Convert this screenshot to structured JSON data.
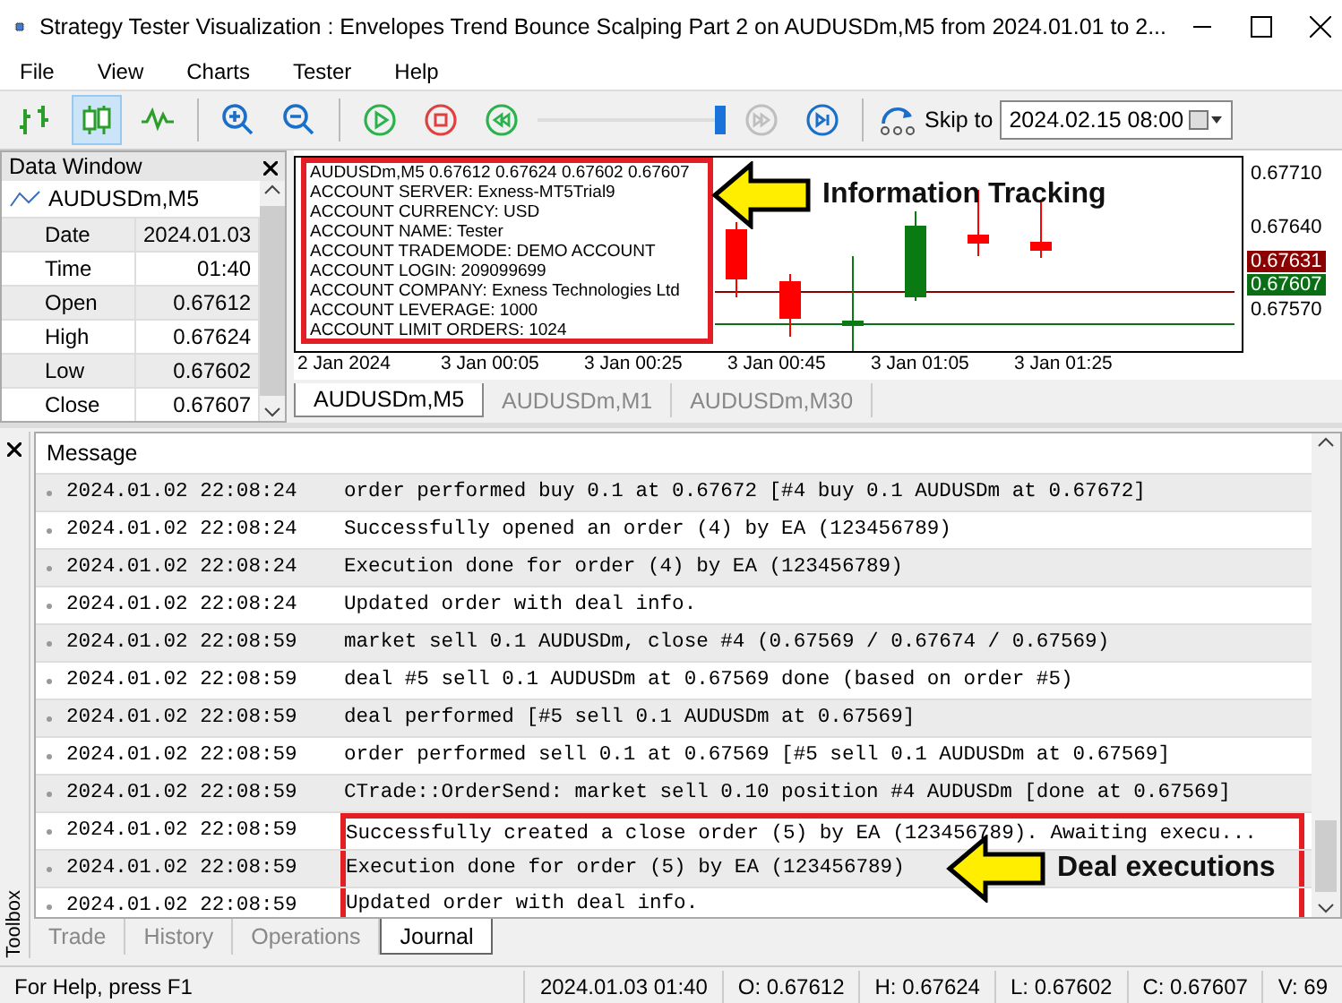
{
  "window": {
    "title": "Strategy Tester Visualization : Envelopes Trend Bounce Scalping Part 2 on AUDUSDm,M5 from 2024.01.01 to 2..."
  },
  "menu": [
    "File",
    "View",
    "Charts",
    "Tester",
    "Help"
  ],
  "toolbar": {
    "chart_types": [
      {
        "kind": "bars",
        "selected": false
      },
      {
        "kind": "candles",
        "selected": true
      },
      {
        "kind": "line",
        "selected": false
      }
    ],
    "zoom": [
      {
        "kind": "zoom-in"
      },
      {
        "kind": "zoom-out"
      }
    ],
    "playback": [
      {
        "kind": "play",
        "disabled": false
      },
      {
        "kind": "stop",
        "disabled": false
      },
      {
        "kind": "rewind",
        "disabled": false
      }
    ],
    "speed": {
      "level": 0.97
    },
    "stepping": [
      {
        "kind": "fast-forward",
        "disabled": true
      },
      {
        "kind": "step",
        "disabled": false
      }
    ],
    "skip_to": {
      "label": "Skip to",
      "value": "2024.02.15 08:00"
    }
  },
  "data_window": {
    "title": "Data Window",
    "symbol": "AUDUSDm,M5",
    "rows": [
      {
        "label": "Date",
        "value": "2024.01.03"
      },
      {
        "label": "Time",
        "value": "01:40"
      },
      {
        "label": "Open",
        "value": "0.67612"
      },
      {
        "label": "High",
        "value": "0.67624"
      },
      {
        "label": "Low",
        "value": "0.67602"
      },
      {
        "label": "Close",
        "value": "0.67607"
      }
    ]
  },
  "chart": {
    "info_lines": [
      "AUDUSDm,M5  0.67612 0.67624 0.67602 0.67607",
      "ACCOUNT SERVER:  Exness-MT5Trial9",
      "ACCOUNT CURRENCY:  USD",
      "ACCOUNT NAME:  Tester",
      "ACCOUNT TRADEMODE:  DEMO ACCOUNT",
      "ACCOUNT LOGIN:  209099699",
      "ACCOUNT COMPANY:  Exness Technologies Ltd",
      "ACCOUNT LEVERAGE:  1000",
      "ACCOUNT LIMIT ORDERS:  1024"
    ],
    "annotation": "Information Tracking",
    "price_labels": [
      {
        "text": "0.67710",
        "kind": "axis"
      },
      {
        "text": "0.67640",
        "kind": "axis"
      },
      {
        "text": "0.67631",
        "kind": "ask"
      },
      {
        "text": "0.67607",
        "kind": "bid"
      },
      {
        "text": "0.67570",
        "kind": "axis"
      }
    ],
    "time_labels": [
      "2 Jan 2024",
      "3 Jan 00:05",
      "3 Jan 00:25",
      "3 Jan 00:45",
      "3 Jan 01:05",
      "3 Jan 01:25"
    ],
    "tabs": [
      {
        "label": "AUDUSDm,M5",
        "selected": true
      },
      {
        "label": "AUDUSDm,M1",
        "selected": false
      },
      {
        "label": "AUDUSDm,M30",
        "selected": false
      }
    ]
  },
  "toolbox": {
    "title": "Toolbox",
    "column": "Message",
    "annotation": "Deal executions",
    "rows": [
      {
        "time": "2024.01.02 22:08:24",
        "message": "order performed buy 0.1 at 0.67672 [#4 buy 0.1 AUDUSDm at 0.67672]",
        "highlighted": false
      },
      {
        "time": "2024.01.02 22:08:24",
        "message": "Successfully opened an order (4) by EA (123456789)",
        "highlighted": false
      },
      {
        "time": "2024.01.02 22:08:24",
        "message": "Execution done for order (4) by EA (123456789)",
        "highlighted": false
      },
      {
        "time": "2024.01.02 22:08:24",
        "message": "Updated order with deal info.",
        "highlighted": false
      },
      {
        "time": "2024.01.02 22:08:59",
        "message": "market sell 0.1 AUDUSDm, close #4 (0.67569 / 0.67674 / 0.67569)",
        "highlighted": false
      },
      {
        "time": "2024.01.02 22:08:59",
        "message": "deal #5 sell 0.1 AUDUSDm at 0.67569 done (based on order #5)",
        "highlighted": false
      },
      {
        "time": "2024.01.02 22:08:59",
        "message": "deal performed [#5 sell 0.1 AUDUSDm at 0.67569]",
        "highlighted": false
      },
      {
        "time": "2024.01.02 22:08:59",
        "message": "order performed sell 0.1 at 0.67569 [#5 sell 0.1 AUDUSDm at 0.67569]",
        "highlighted": false
      },
      {
        "time": "2024.01.02 22:08:59",
        "message": "CTrade::OrderSend: market sell 0.10 position #4 AUDUSDm [done at 0.67569]",
        "highlighted": false
      },
      {
        "time": "2024.01.02 22:08:59",
        "message": "Successfully created a close order (5) by EA (123456789). Awaiting execu...",
        "highlighted": true
      },
      {
        "time": "2024.01.02 22:08:59",
        "message": "Execution done for order (5) by EA (123456789)",
        "highlighted": true
      },
      {
        "time": "2024.01.02 22:08:59",
        "message": "Updated order with deal info.",
        "highlighted": true
      }
    ],
    "tabs": [
      {
        "label": "Trade",
        "selected": false
      },
      {
        "label": "History",
        "selected": false
      },
      {
        "label": "Operations",
        "selected": false
      },
      {
        "label": "Journal",
        "selected": true
      }
    ]
  },
  "status_bar": [
    "For Help, press F1",
    "2024.01.03 01:40",
    "O: 0.67612",
    "H: 0.67624",
    "L: 0.67602",
    "C: 0.67607",
    "V: 69"
  ]
}
